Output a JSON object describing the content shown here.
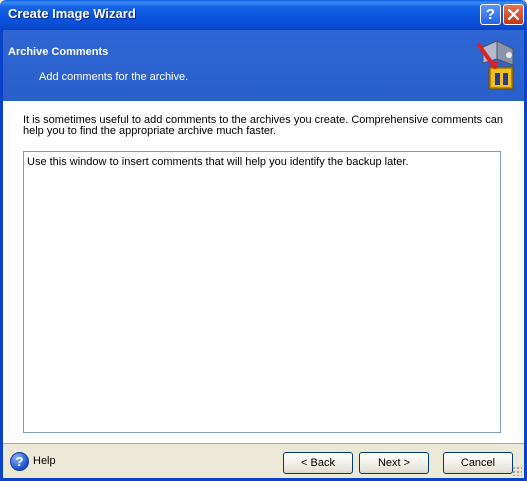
{
  "window": {
    "title": "Create Image Wizard"
  },
  "titlebar": {
    "help_glyph": "?",
    "close_glyph": "✕"
  },
  "header": {
    "title": "Archive Comments",
    "subtitle": "Add comments for the archive.",
    "icon": "wizard-archive-icon"
  },
  "content": {
    "description": "It is sometimes useful to add comments to the archives you create. Comprehensive comments can help you to find the appropriate archive much faster.",
    "comment_value": "Use this window to insert comments that will help you identify the backup later."
  },
  "footer": {
    "help_label": "Help",
    "back_label": "< Back",
    "next_label": "Next >",
    "cancel_label": "Cancel"
  },
  "colors": {
    "titlebar": "#0a54dd",
    "header_band": "#2f66d3",
    "window_face": "#ece9d8"
  }
}
